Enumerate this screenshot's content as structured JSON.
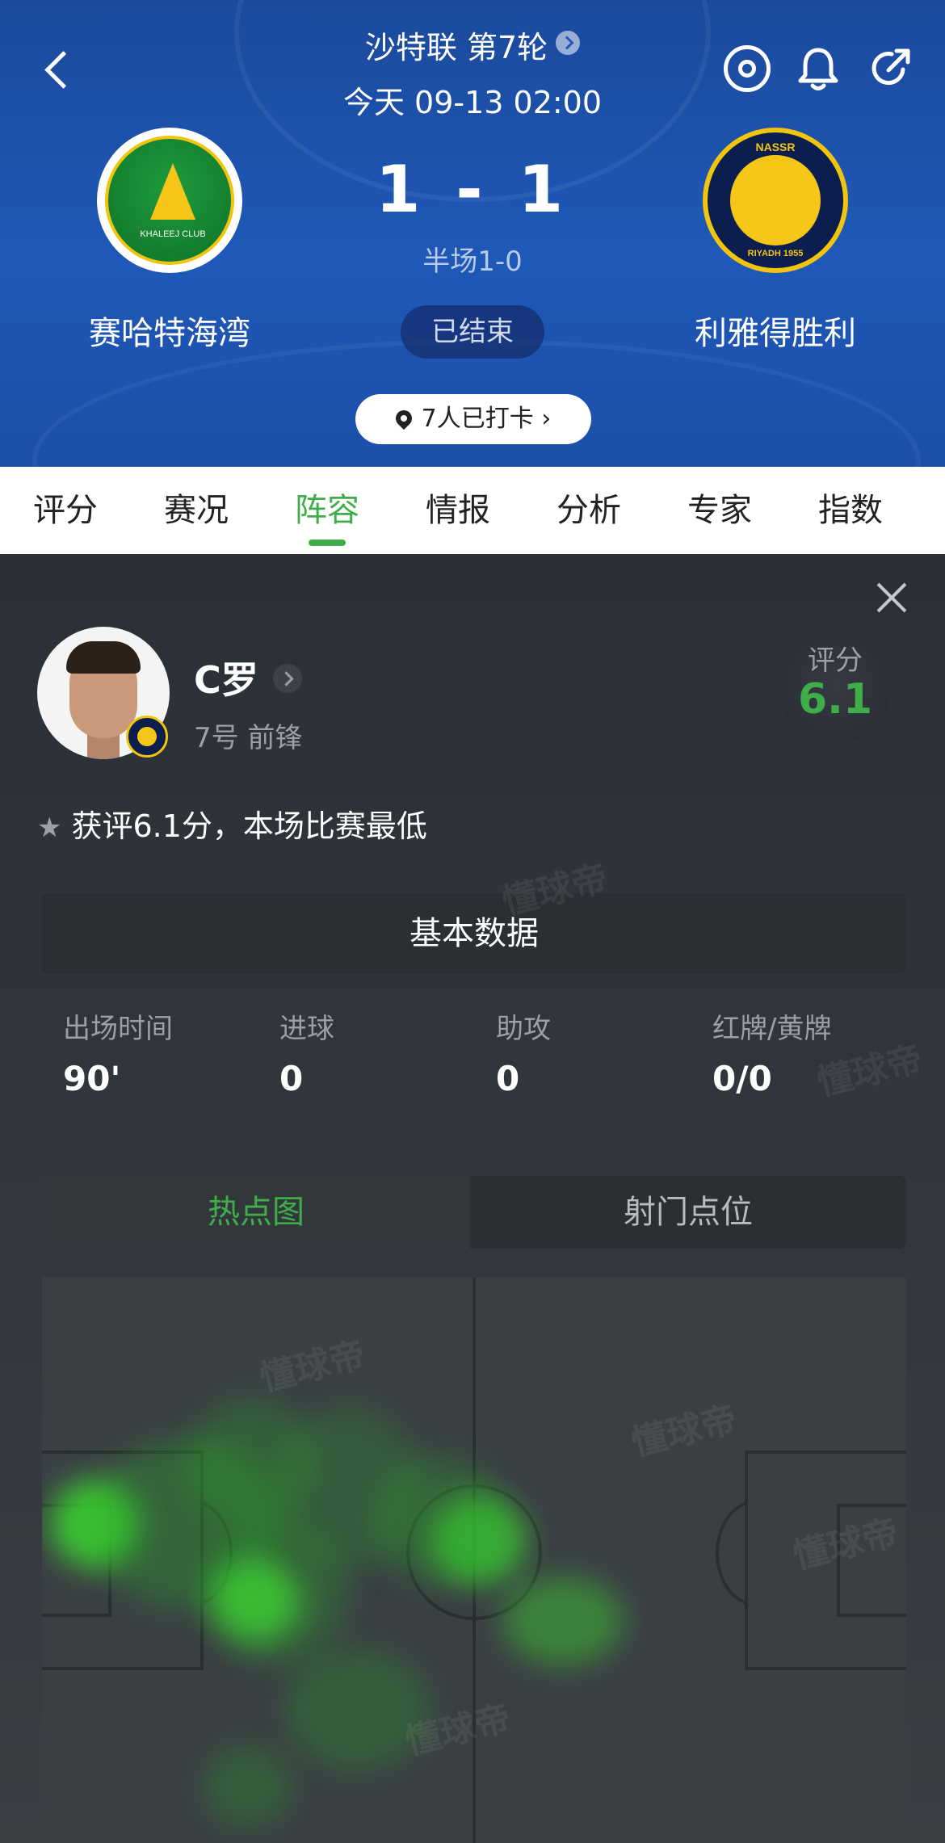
{
  "header": {
    "league": "沙特联 第7轮",
    "match_time": "今天 09-13 02:00",
    "home_team": "赛哈特海湾",
    "away_team": "利雅得胜利",
    "score": "1 - 1",
    "half_score": "半场1-0",
    "status": "已结束",
    "checkin": "7人已打卡",
    "home_logo_text": "KHALEEJ CLUB",
    "away_logo_top": "NASSR",
    "away_logo_bottom": "RIYADH 1955"
  },
  "tabs": [
    "评分",
    "赛况",
    "阵容",
    "情报",
    "分析",
    "专家",
    "指数"
  ],
  "active_tab": "阵容",
  "player": {
    "name": "C罗",
    "position": "7号 前锋",
    "rating_label": "评分",
    "rating": "6.1",
    "note": "获评6.1分，本场比赛最低"
  },
  "basic_stats": {
    "title": "基本数据",
    "items": [
      {
        "label": "出场时间",
        "value": "90'"
      },
      {
        "label": "进球",
        "value": "0"
      },
      {
        "label": "助攻",
        "value": "0"
      },
      {
        "label": "红牌/黄牌",
        "value": "0/0"
      }
    ]
  },
  "map_tabs": {
    "heatmap": "热点图",
    "shots": "射门点位"
  },
  "watermark": "懂球帝",
  "colors": {
    "accent_green": "#3fae4a",
    "header_blue": "#1f58b8",
    "panel_dark": "#2f3338"
  }
}
